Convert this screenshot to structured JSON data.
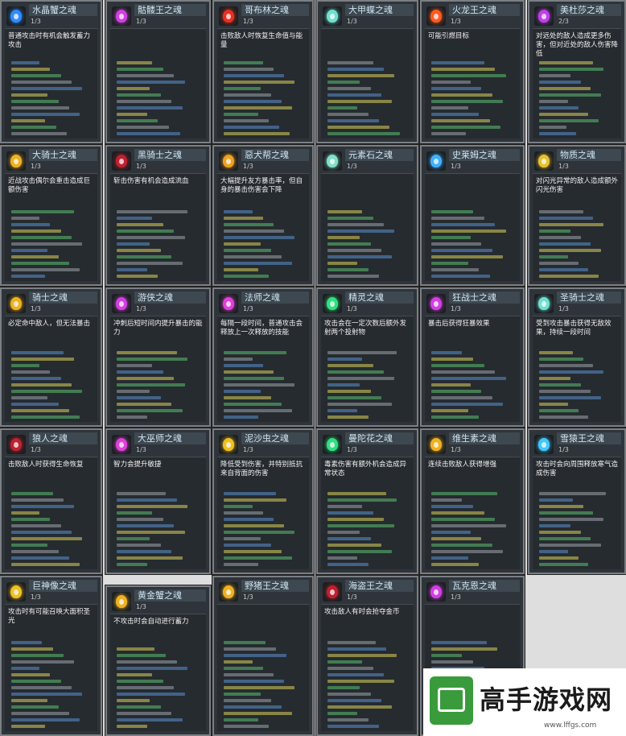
{
  "cards": [
    {
      "name": "水晶蟹之魂",
      "count": "1/3",
      "desc": "普通攻击时有机会触发蓄力攻击",
      "orb": "#2f8cff"
    },
    {
      "name": "骷髅王之魂",
      "count": "1/3",
      "desc": "",
      "orb": "#d040e0"
    },
    {
      "name": "哥布林之魂",
      "count": "1/3",
      "desc": "击败敌人时恢复生命值与能量",
      "orb": "#e83020"
    },
    {
      "name": "大甲蝶之魂",
      "count": "1/3",
      "desc": "",
      "orb": "#70e0d0"
    },
    {
      "name": "火龙王之魂",
      "count": "1/3",
      "desc": "可能引燃目标",
      "orb": "#ff5a20"
    },
    {
      "name": "美杜莎之魂",
      "count": "2/3",
      "desc": "对远处的敌人造成更多伤害，但对近处的敌人伤害降低",
      "orb": "#c040e8"
    },
    {
      "name": "大骑士之魂",
      "count": "1/3",
      "desc": "近战攻击偶尔会重击造成巨额伤害",
      "orb": "#f0b020"
    },
    {
      "name": "黑骑士之魂",
      "count": "1/3",
      "desc": "斩击伤害有机会造成流血",
      "orb": "#c02030"
    },
    {
      "name": "惡犬帮之魂",
      "count": "1/3",
      "desc": "大幅提升友方暴击率，但自身的暴击伤害会下降",
      "orb": "#f0a020"
    },
    {
      "name": "元素石之魂",
      "count": "1/3",
      "desc": "",
      "orb": "#80e0c8"
    },
    {
      "name": "史莱姆之魂",
      "count": "1/3",
      "desc": "",
      "orb": "#40b0ff"
    },
    {
      "name": "物质之魂",
      "count": "1/3",
      "desc": "对闪光异常的敌人造成额外闪光伤害",
      "orb": "#e8c030"
    },
    {
      "name": "骑士之魂",
      "count": "1/3",
      "desc": "必定命中敌人，但无法暴击",
      "orb": "#f0b020"
    },
    {
      "name": "游侠之魂",
      "count": "1/3",
      "desc": "冲刺后短时间内提升暴击的能力",
      "orb": "#d040e0"
    },
    {
      "name": "法师之魂",
      "count": "1/3",
      "desc": "每隔一段时间，普通攻击会释放上一次释放的技能",
      "orb": "#e040d8"
    },
    {
      "name": "精灵之魂",
      "count": "1/3",
      "desc": "攻击会在一定次数后额外发射两个投射物",
      "orb": "#30e080"
    },
    {
      "name": "狂战士之魂",
      "count": "1/3",
      "desc": "暴击后获得狂暴效果",
      "orb": "#d040e0"
    },
    {
      "name": "圣骑士之魂",
      "count": "1/3",
      "desc": "受到攻击暴击获得无敌效果，持续一段时间",
      "orb": "#70e0d0"
    },
    {
      "name": "狼人之魂",
      "count": "1/3",
      "desc": "击败敌人时获得生命恢复",
      "orb": "#c02030"
    },
    {
      "name": "大巫师之魂",
      "count": "1/3",
      "desc": "智力会提升敏捷",
      "orb": "#e040d8"
    },
    {
      "name": "泥沙虫之魂",
      "count": "1/3",
      "desc": "降低受到伤害，并特别抵抗来自背面的伤害",
      "orb": "#f0c020"
    },
    {
      "name": "曼陀花之魂",
      "count": "1/3",
      "desc": "毒素伤害有额外机会造成异常状态",
      "orb": "#30e080"
    },
    {
      "name": "维生素之魂",
      "count": "1/3",
      "desc": "连续击败敌人获得增强",
      "orb": "#f0b020"
    },
    {
      "name": "雪猿王之魂",
      "count": "1/3",
      "desc": "攻击时会向周围释放寒气造成伤害",
      "orb": "#40c8ff"
    },
    {
      "name": "巨神像之魂",
      "count": "1/3",
      "desc": "攻击时有可能召唤大面积圣光",
      "orb": "#f0c020"
    },
    {
      "name": "黄金蟹之魂",
      "count": "1/3",
      "desc": "不攻击时会自动进行蓄力",
      "orb": "#f0b020"
    },
    {
      "name": "野猪王之魂",
      "count": "1/3",
      "desc": "",
      "orb": "#f0b020"
    },
    {
      "name": "海盗王之魂",
      "count": "1/3",
      "desc": "攻击敌人有时会抢夺金币",
      "orb": "#c02030"
    },
    {
      "name": "瓦克恩之魂",
      "count": "1/3",
      "desc": "",
      "orb": "#d040e0"
    }
  ],
  "brand": {
    "title": "高手游戏网",
    "url": "www.lffgs.com"
  }
}
